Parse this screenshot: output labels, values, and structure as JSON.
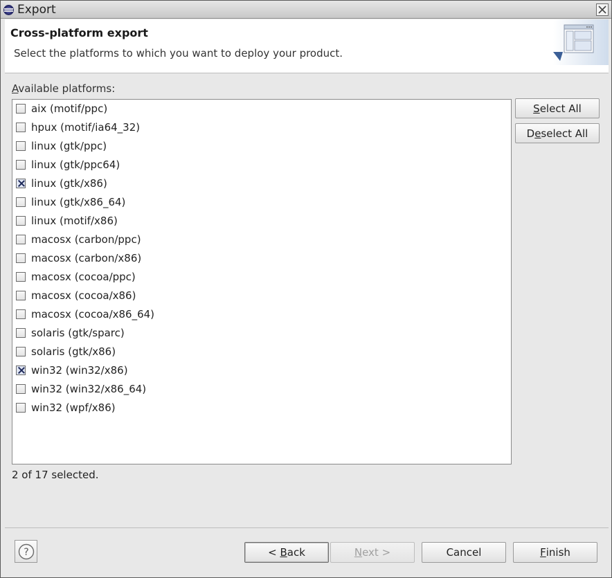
{
  "window": {
    "title": "Export"
  },
  "header": {
    "title": "Cross-platform export",
    "description": "Select the platforms to which you want to deploy your product."
  },
  "platforms": {
    "label_prefix": "A",
    "label_rest": "vailable platforms:",
    "items": [
      {
        "label": "aix (motif/ppc)",
        "checked": false
      },
      {
        "label": "hpux (motif/ia64_32)",
        "checked": false
      },
      {
        "label": "linux (gtk/ppc)",
        "checked": false
      },
      {
        "label": "linux (gtk/ppc64)",
        "checked": false
      },
      {
        "label": "linux (gtk/x86)",
        "checked": true
      },
      {
        "label": "linux (gtk/x86_64)",
        "checked": false
      },
      {
        "label": "linux (motif/x86)",
        "checked": false
      },
      {
        "label": "macosx (carbon/ppc)",
        "checked": false
      },
      {
        "label": "macosx (carbon/x86)",
        "checked": false
      },
      {
        "label": "macosx (cocoa/ppc)",
        "checked": false
      },
      {
        "label": "macosx (cocoa/x86)",
        "checked": false
      },
      {
        "label": "macosx (cocoa/x86_64)",
        "checked": false
      },
      {
        "label": "solaris (gtk/sparc)",
        "checked": false
      },
      {
        "label": "solaris (gtk/x86)",
        "checked": false
      },
      {
        "label": "win32 (win32/x86)",
        "checked": true
      },
      {
        "label": "win32 (win32/x86_64)",
        "checked": false
      },
      {
        "label": "win32 (wpf/x86)",
        "checked": false
      }
    ],
    "status": "2 of 17 selected."
  },
  "side_buttons": {
    "select_all_mnemonic": "S",
    "select_all_rest": "elect All",
    "deselect_all_pre": "D",
    "deselect_all_mnemonic": "e",
    "deselect_all_rest": "select All"
  },
  "footer": {
    "back_pre": "< ",
    "back_mnemonic": "B",
    "back_rest": "ack",
    "next_mnemonic": "N",
    "next_rest": "ext >",
    "cancel": "Cancel",
    "finish_mnemonic": "F",
    "finish_rest": "inish",
    "help_icon": "?"
  },
  "icons": {
    "window_icon": "eclipse-icon",
    "close": "close-icon",
    "help": "help-icon",
    "banner": "wizard-banner-icon"
  }
}
